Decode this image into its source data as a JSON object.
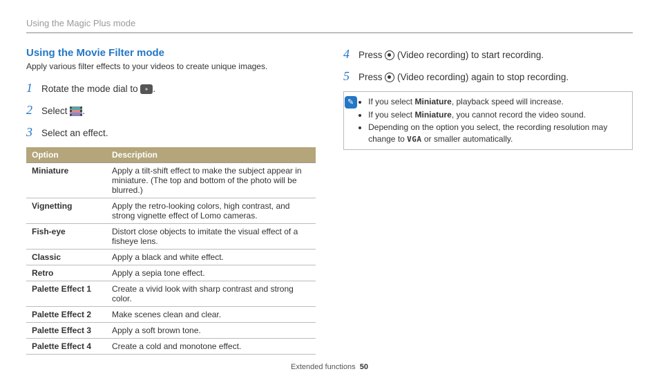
{
  "header": "Using the Magic Plus mode",
  "left": {
    "title": "Using the Movie Filter mode",
    "desc": "Apply various filter effects to your videos to create unique images.",
    "steps": {
      "s1_pre": "Rotate the mode dial to ",
      "s1_post": ".",
      "s2_pre": "Select ",
      "s2_post": ".",
      "s3": "Select an effect."
    },
    "table": {
      "h1": "Option",
      "h2": "Description",
      "rows": [
        {
          "opt": "Miniature",
          "desc": "Apply a tilt-shift effect to make the subject appear in miniature. (The top and bottom of the photo will be blurred.)"
        },
        {
          "opt": "Vignetting",
          "desc": "Apply the retro-looking colors, high contrast, and strong vignette effect of Lomo cameras."
        },
        {
          "opt": "Fish-eye",
          "desc": "Distort close objects to imitate the visual effect of a fisheye lens."
        },
        {
          "opt": "Classic",
          "desc": "Apply a black and white effect."
        },
        {
          "opt": "Retro",
          "desc": "Apply a sepia tone effect."
        },
        {
          "opt": "Palette Effect 1",
          "desc": "Create a vivid look with sharp contrast and strong color."
        },
        {
          "opt": "Palette Effect 2",
          "desc": "Make scenes clean and clear."
        },
        {
          "opt": "Palette Effect 3",
          "desc": "Apply a soft brown tone."
        },
        {
          "opt": "Palette Effect 4",
          "desc": "Create a cold and monotone effect."
        }
      ]
    }
  },
  "right": {
    "s4_pre": "Press ",
    "s4_post": " (Video recording) to start recording.",
    "s5_pre": "Press ",
    "s5_post": " (Video recording) again to stop recording.",
    "note": {
      "n1_pre": "If you select ",
      "n1_bold": "Miniature",
      "n1_post": ", playback speed will increase.",
      "n2_pre": "If you select ",
      "n2_bold": "Miniature",
      "n2_post": ", you cannot record the video sound.",
      "n3_pre": "Depending on the option you select, the recording resolution may change to ",
      "n3_vga": "VGA",
      "n3_post": " or smaller automatically."
    }
  },
  "footer": {
    "section": "Extended functions",
    "page": "50"
  }
}
